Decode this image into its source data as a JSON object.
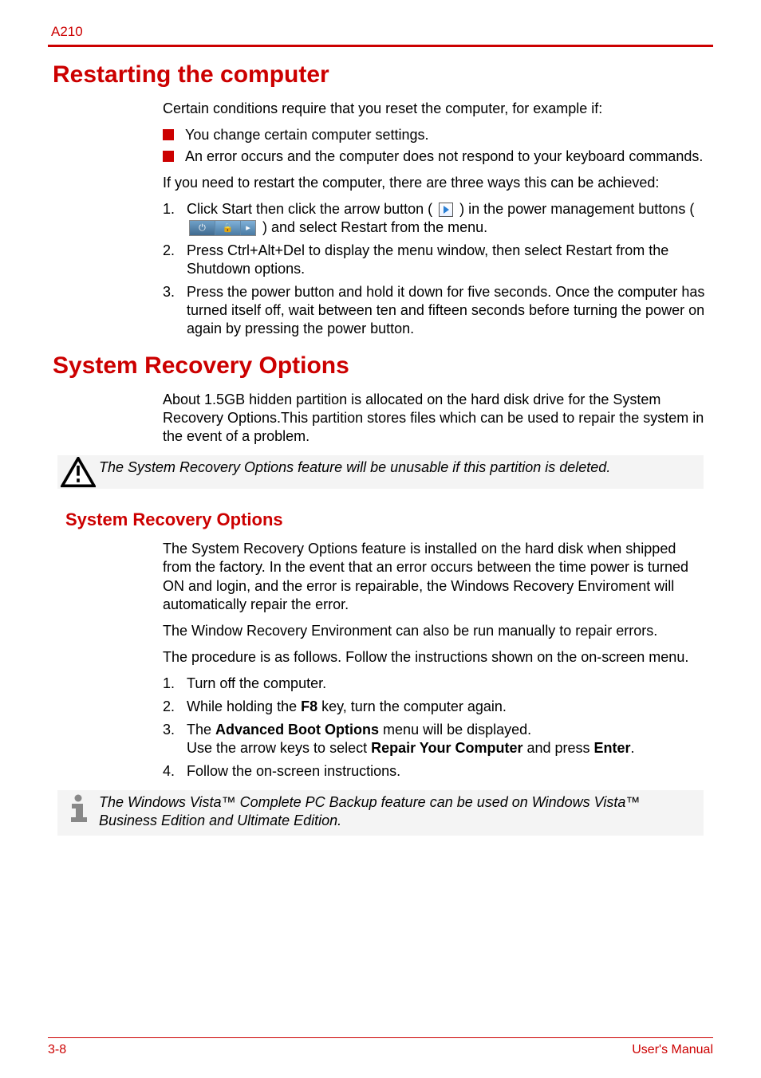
{
  "header": {
    "model": "A210"
  },
  "footer": {
    "pagenum": "3-8",
    "manual": "User's Manual"
  },
  "s1": {
    "title": "Restarting the computer",
    "intro": "Certain conditions require that you reset the computer, for example if:",
    "bullets": [
      "You change certain computer settings.",
      "An error occurs and the computer does not respond to your keyboard commands."
    ],
    "p2": "If you need to restart the computer, there are three ways this can be achieved:",
    "steps": {
      "n1": "1.",
      "t1a": "Click Start then click the arrow button (",
      "t1b": ") in the power management buttons (",
      "t1c": ") and select Restart from the menu.",
      "n2": "2.",
      "t2": "Press Ctrl+Alt+Del to display the menu window, then select Restart from the Shutdown options.",
      "n3": "3.",
      "t3": "Press the power button and hold it down for five seconds. Once the computer has turned itself off, wait between ten and fifteen seconds before turning the power on again by pressing the power button."
    }
  },
  "s2": {
    "title": "System Recovery Options",
    "intro": "About 1.5GB hidden partition is allocated on the hard disk drive for the System Recovery Options.This partition stores files which can be used to repair the system in the event of a problem.",
    "warn": "The System Recovery Options feature will be unusable if this partition is deleted.",
    "subhead": "System Recovery Options",
    "p1": "The System Recovery Options feature is installed on the hard disk when shipped from the factory. In the event that an error occurs between the time power is turned ON and login, and the error is repairable, the Windows Recovery Enviroment will automatically repair the error.",
    "p2": "The Window Recovery Environment can also be run manually to repair errors.",
    "p3": "The procedure is as follows. Follow the instructions shown on the on-screen menu.",
    "steps": {
      "n1": "1.",
      "t1": "Turn off the computer.",
      "n2": "2.",
      "t2a": "While holding the ",
      "t2b": "F8",
      "t2c": " key, turn the computer again.",
      "n3": "3.",
      "t3a": "The ",
      "t3b": "Advanced Boot Options",
      "t3c": " menu will be displayed.",
      "t3d": "Use the arrow keys to select ",
      "t3e": "Repair Your Computer",
      "t3f": " and press ",
      "t3g": "Enter",
      "t3h": ".",
      "n4": "4.",
      "t4": "Follow the on-screen instructions."
    },
    "info": "The Windows Vista™ Complete PC Backup feature can be used on Windows Vista™ Business Edition and Ultimate Edition."
  }
}
